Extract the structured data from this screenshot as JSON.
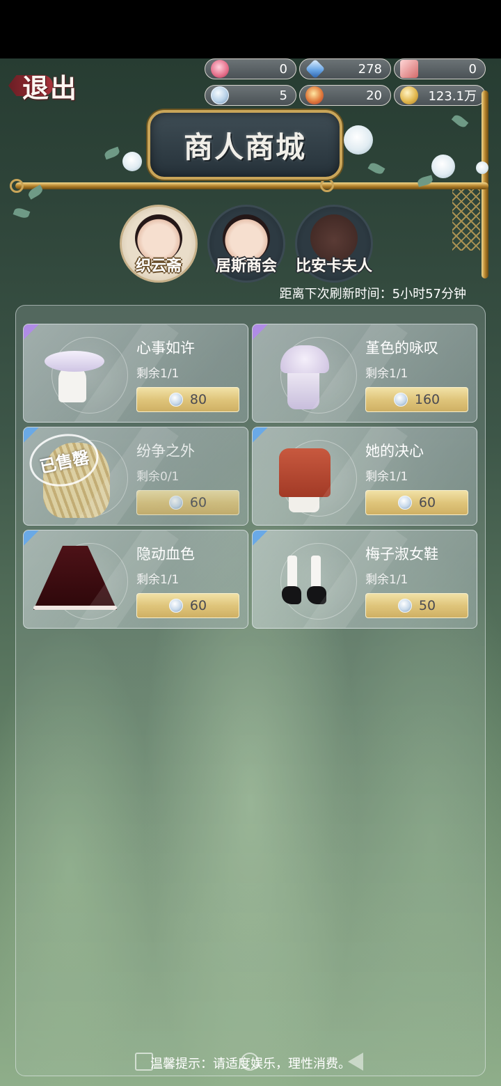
{
  "header": {
    "exit_label": "退出",
    "title": "商人商城"
  },
  "currencies": [
    {
      "icon": "rose-gem-icon",
      "value": "0"
    },
    {
      "icon": "blue-crystal-icon",
      "value": "278"
    },
    {
      "icon": "ticket-icon",
      "value": "0"
    },
    {
      "icon": "button-coin-icon",
      "value": "5"
    },
    {
      "icon": "heart-medal-icon",
      "value": "20"
    },
    {
      "icon": "gold-coins-icon",
      "value": "123.1万"
    }
  ],
  "merchants": [
    {
      "name": "织云斋",
      "active": true
    },
    {
      "name": "居斯商会",
      "active": false
    },
    {
      "name": "比安卡夫人",
      "active": false
    }
  ],
  "refresh_text": "距离下次刷新时间：5小时57分钟",
  "sold_stamp": "已售罄",
  "items": [
    {
      "name": "心事如许",
      "stock": "剩余1/1",
      "price": "80",
      "corner": "#b08ce6"
    },
    {
      "name": "堇色的咏叹",
      "stock": "剩余1/1",
      "price": "160",
      "corner": "#b08ce6"
    },
    {
      "name": "纷争之外",
      "stock": "剩余0/1",
      "price": "60",
      "corner": "#6aa9e6",
      "sold": true
    },
    {
      "name": "她的决心",
      "stock": "剩余1/1",
      "price": "60",
      "corner": "#6aa9e6"
    },
    {
      "name": "隐动血色",
      "stock": "剩余1/1",
      "price": "60",
      "corner": "#6aa9e6"
    },
    {
      "name": "梅子淑女鞋",
      "stock": "剩余1/1",
      "price": "50",
      "corner": "#6aa9e6"
    }
  ],
  "footer_tip": "温馨提示：请适度娱乐，理性消费。"
}
